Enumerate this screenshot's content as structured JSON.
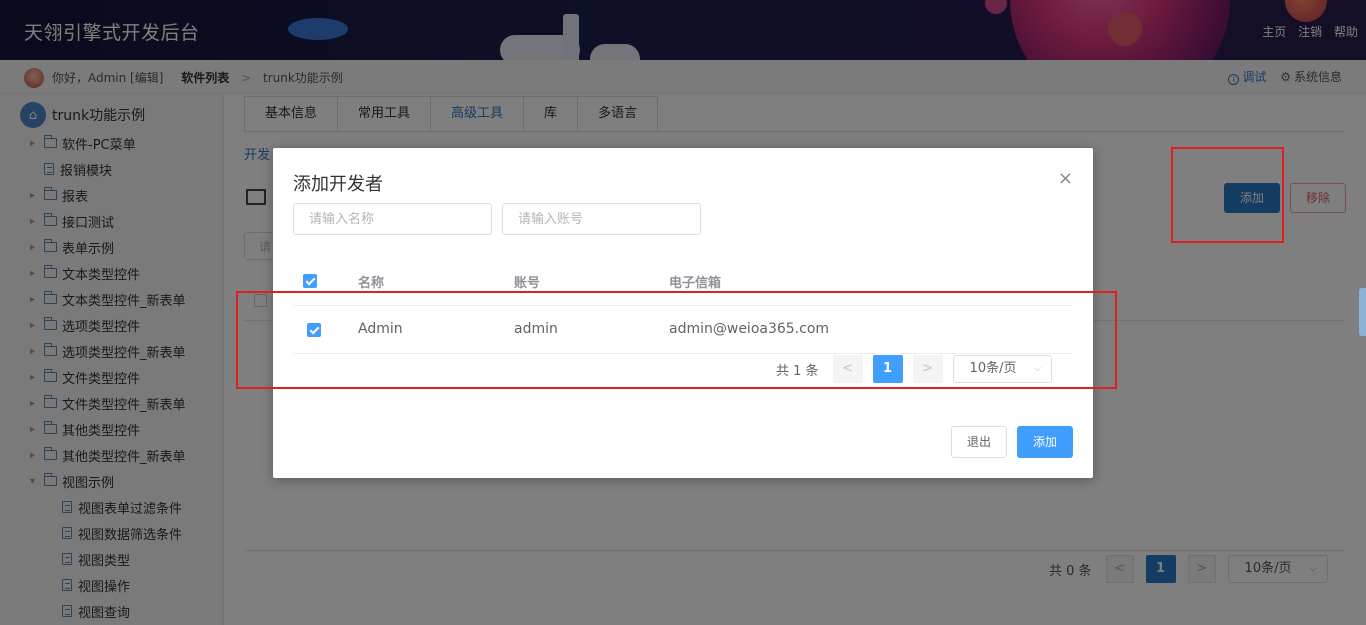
{
  "header": {
    "app_title": "天翎引擎式开发后台",
    "links": [
      "主页",
      "注销",
      "帮助"
    ]
  },
  "subbar": {
    "greeting": "你好，Admin [编辑]",
    "crumb_bold": "软件列表",
    "crumb_sep": ">",
    "crumb_current": "trunk功能示例",
    "debug": "调试",
    "system_info": "系统信息"
  },
  "sidebar": {
    "root": "trunk功能示例",
    "items": [
      {
        "label": "软件-PC菜单",
        "type": "folder"
      },
      {
        "label": "报销模块",
        "type": "file"
      },
      {
        "label": "报表",
        "type": "folder"
      },
      {
        "label": "接口测试",
        "type": "folder"
      },
      {
        "label": "表单示例",
        "type": "folder"
      },
      {
        "label": "文本类型控件",
        "type": "folder"
      },
      {
        "label": "文本类型控件_新表单",
        "type": "folder"
      },
      {
        "label": "选项类型控件",
        "type": "folder"
      },
      {
        "label": "选项类型控件_新表单",
        "type": "folder"
      },
      {
        "label": "文件类型控件",
        "type": "folder"
      },
      {
        "label": "文件类型控件_新表单",
        "type": "folder"
      },
      {
        "label": "其他类型控件",
        "type": "folder"
      },
      {
        "label": "其他类型控件_新表单",
        "type": "folder"
      },
      {
        "label": "视图示例",
        "type": "folder-open"
      },
      {
        "label": "视图表单过滤条件",
        "type": "file-child"
      },
      {
        "label": "视图数据筛选条件",
        "type": "file-child"
      },
      {
        "label": "视图类型",
        "type": "file-child"
      },
      {
        "label": "视图操作",
        "type": "file-child"
      },
      {
        "label": "视图查询",
        "type": "file-child"
      }
    ]
  },
  "main": {
    "tabs": [
      "基本信息",
      "常用工具",
      "高级工具",
      "库",
      "多语言"
    ],
    "active_tab": "高级工具",
    "subtab_visible": "开发",
    "search_stub": "请",
    "add_button": "添加",
    "remove_button": "移除",
    "pager": {
      "total": "共 0 条",
      "prev": "<",
      "current": "1",
      "next": ">",
      "page_size": "10条/页"
    }
  },
  "modal": {
    "title": "添加开发者",
    "close": "×",
    "name_placeholder": "请输入名称",
    "account_placeholder": "请输入账号",
    "columns": [
      "名称",
      "账号",
      "电子信箱"
    ],
    "rows": [
      {
        "name": "Admin",
        "account": "admin",
        "email": "admin@weioa365.com",
        "checked": true
      }
    ],
    "pager": {
      "total": "共 1 条",
      "prev": "<",
      "current": "1",
      "next": ">",
      "page_size": "10条/页"
    },
    "exit_button": "退出",
    "add_button": "添加"
  },
  "colors": {
    "primary": "#409eff",
    "main_primary": "#2b78c5",
    "annotation_red": "#e02020",
    "header_bg": "#1e2050"
  }
}
